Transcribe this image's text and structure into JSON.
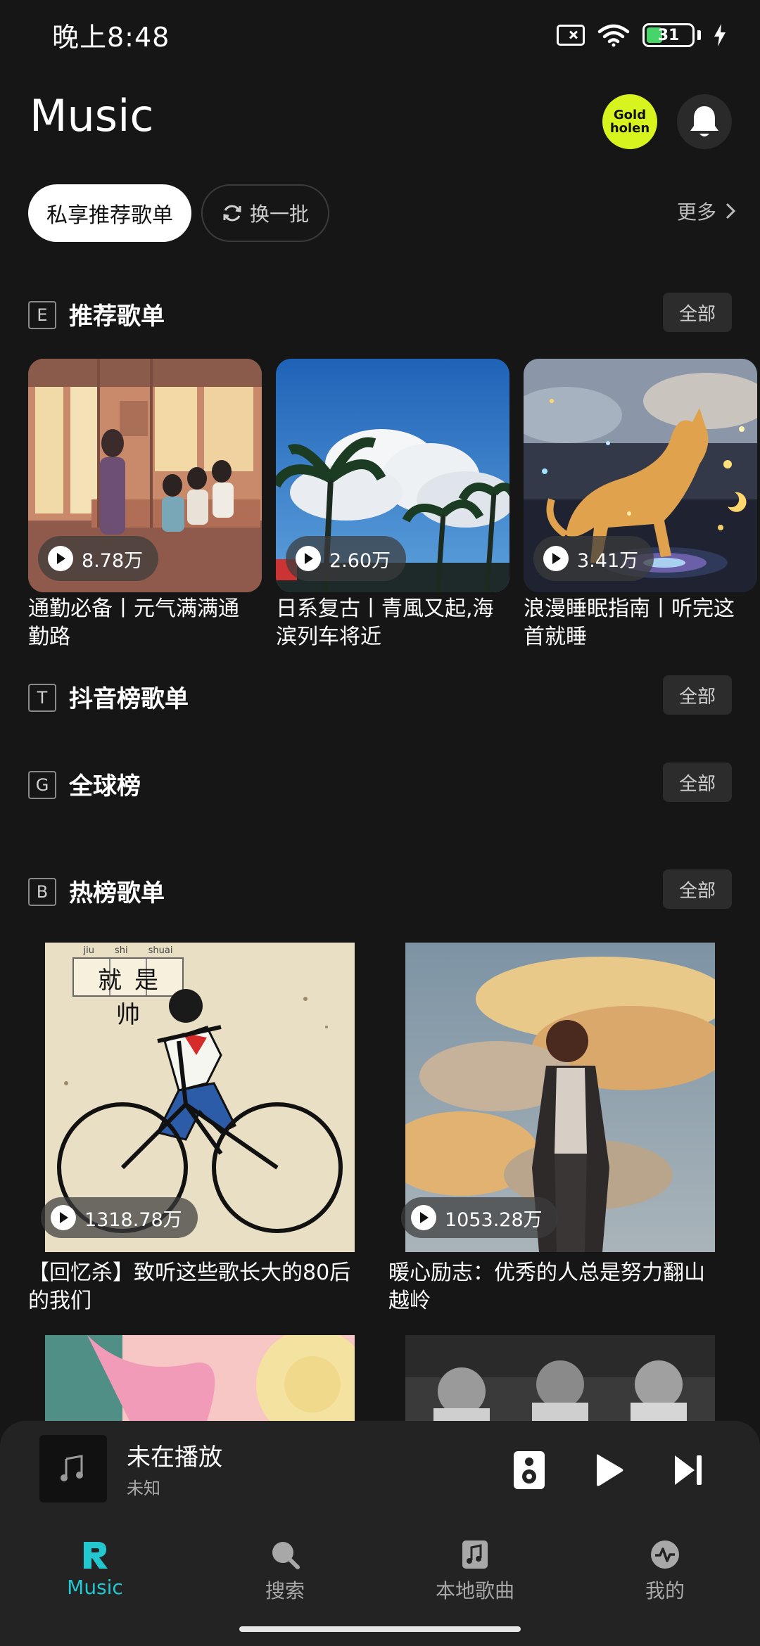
{
  "status_bar": {
    "time": "晚上8:48",
    "battery": "31",
    "battery_color": "#46d46b"
  },
  "header": {
    "title": "Music",
    "badge_line1": "Gold",
    "badge_line2": "holen",
    "badge_color": "#d8f41e",
    "bell_icon": "bell-icon"
  },
  "chips": {
    "primary": "私享推荐歌单",
    "refresh": "换一批",
    "more": "更多"
  },
  "sections": {
    "recommended": {
      "letter": "E",
      "title": "推荐歌单",
      "all": "全部"
    },
    "douyin": {
      "letter": "T",
      "title": "抖音榜歌单",
      "all": "全部"
    },
    "global": {
      "letter": "G",
      "title": "全球榜",
      "all": "全部"
    },
    "hot": {
      "letter": "B",
      "title": "热榜歌单",
      "all": "全部"
    }
  },
  "recommended_cards": [
    {
      "plays": "8.78万",
      "title_line1": "通勤必备丨元气满满通",
      "title_line2": "勤路"
    },
    {
      "plays": "2.60万",
      "title_line1": "日系复古丨青風又起,海",
      "title_line2": "滨列车将近"
    },
    {
      "plays": "3.41万",
      "title_line1": "浪漫睡眠指南丨听完这",
      "title_line2": "首就睡"
    }
  ],
  "hot_cards": [
    {
      "plays": "1318.78万",
      "title_line1": "【回忆杀】致听这些歌长大的80后",
      "title_line2": "的我们",
      "cover_text": "就是帅",
      "pinyin": [
        "jiu",
        "shi",
        "shuai"
      ]
    },
    {
      "plays": "1053.28万",
      "title_line1": "暖心励志：优秀的人总是努力翻山",
      "title_line2": "越岭"
    }
  ],
  "player": {
    "title": "未在播放",
    "artist": "未知"
  },
  "nav": {
    "music": "Music",
    "search": "搜索",
    "local": "本地歌曲",
    "mine": "我的",
    "accent": "#22c7cf"
  }
}
